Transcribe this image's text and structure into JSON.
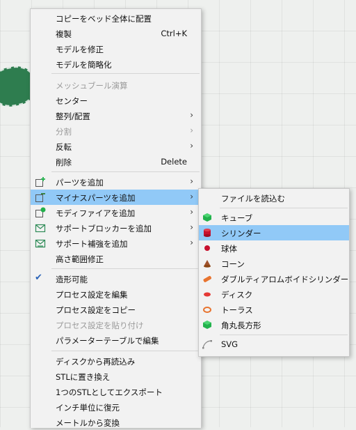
{
  "context_menu": {
    "items": [
      {
        "label": "コピーをベッド全体に配置"
      },
      {
        "label": "複製",
        "shortcut": "Ctrl+K"
      },
      {
        "label": "モデルを修正"
      },
      {
        "label": "モデルを簡略化"
      },
      {
        "label": "メッシュブール演算"
      },
      {
        "label": "センター"
      },
      {
        "label": "整列/配置",
        "submenu_arrow": "›"
      },
      {
        "label": "分割",
        "submenu_arrow": "›"
      },
      {
        "label": "反転",
        "submenu_arrow": "›"
      },
      {
        "label": "削除",
        "shortcut": "Delete"
      },
      {
        "label": "パーツを追加",
        "submenu_arrow": "›"
      },
      {
        "label": "マイナスパーツを追加",
        "submenu_arrow": "›"
      },
      {
        "label": "モディファイアを追加",
        "submenu_arrow": "›"
      },
      {
        "label": "サポートブロッカーを追加",
        "submenu_arrow": "›"
      },
      {
        "label": "サポート補強を追加",
        "submenu_arrow": "›"
      },
      {
        "label": "高さ範囲修正"
      },
      {
        "label": "造形可能",
        "check": "✔"
      },
      {
        "label": "プロセス設定を編集"
      },
      {
        "label": "プロセス設定をコピー"
      },
      {
        "label": "プロセス設定を貼り付け"
      },
      {
        "label": "パラメーターテーブルで編集"
      },
      {
        "label": "ディスクから再読込み"
      },
      {
        "label": "STLに置き換え"
      },
      {
        "label": "1つのSTLとしてエクスポート"
      },
      {
        "label": "インチ単位に復元"
      },
      {
        "label": "メートルから変換"
      }
    ]
  },
  "submenu": {
    "items": [
      {
        "label": "ファイルを読込む"
      },
      {
        "label": "キューブ",
        "icon": "cube-icon",
        "color": "#22b14c"
      },
      {
        "label": "シリンダー",
        "icon": "cylinder-icon",
        "color": "#c8102e"
      },
      {
        "label": "球体",
        "icon": "sphere-icon",
        "color": "#c8102e"
      },
      {
        "label": "コーン",
        "icon": "cone-icon",
        "color": "#a0522d"
      },
      {
        "label": "ダブルティアロムボイドシリンダー",
        "icon": "teardrop-cylinder-icon",
        "color": "#e8742f"
      },
      {
        "label": "ディスク",
        "icon": "disk-icon",
        "color": "#e53935"
      },
      {
        "label": "トーラス",
        "icon": "torus-icon",
        "color": "#e8742f"
      },
      {
        "label": "角丸長方形",
        "icon": "rounded-rectangle-icon",
        "color": "#22b14c"
      },
      {
        "label": "SVG",
        "icon": "svg-icon",
        "color": "#888888"
      }
    ]
  }
}
